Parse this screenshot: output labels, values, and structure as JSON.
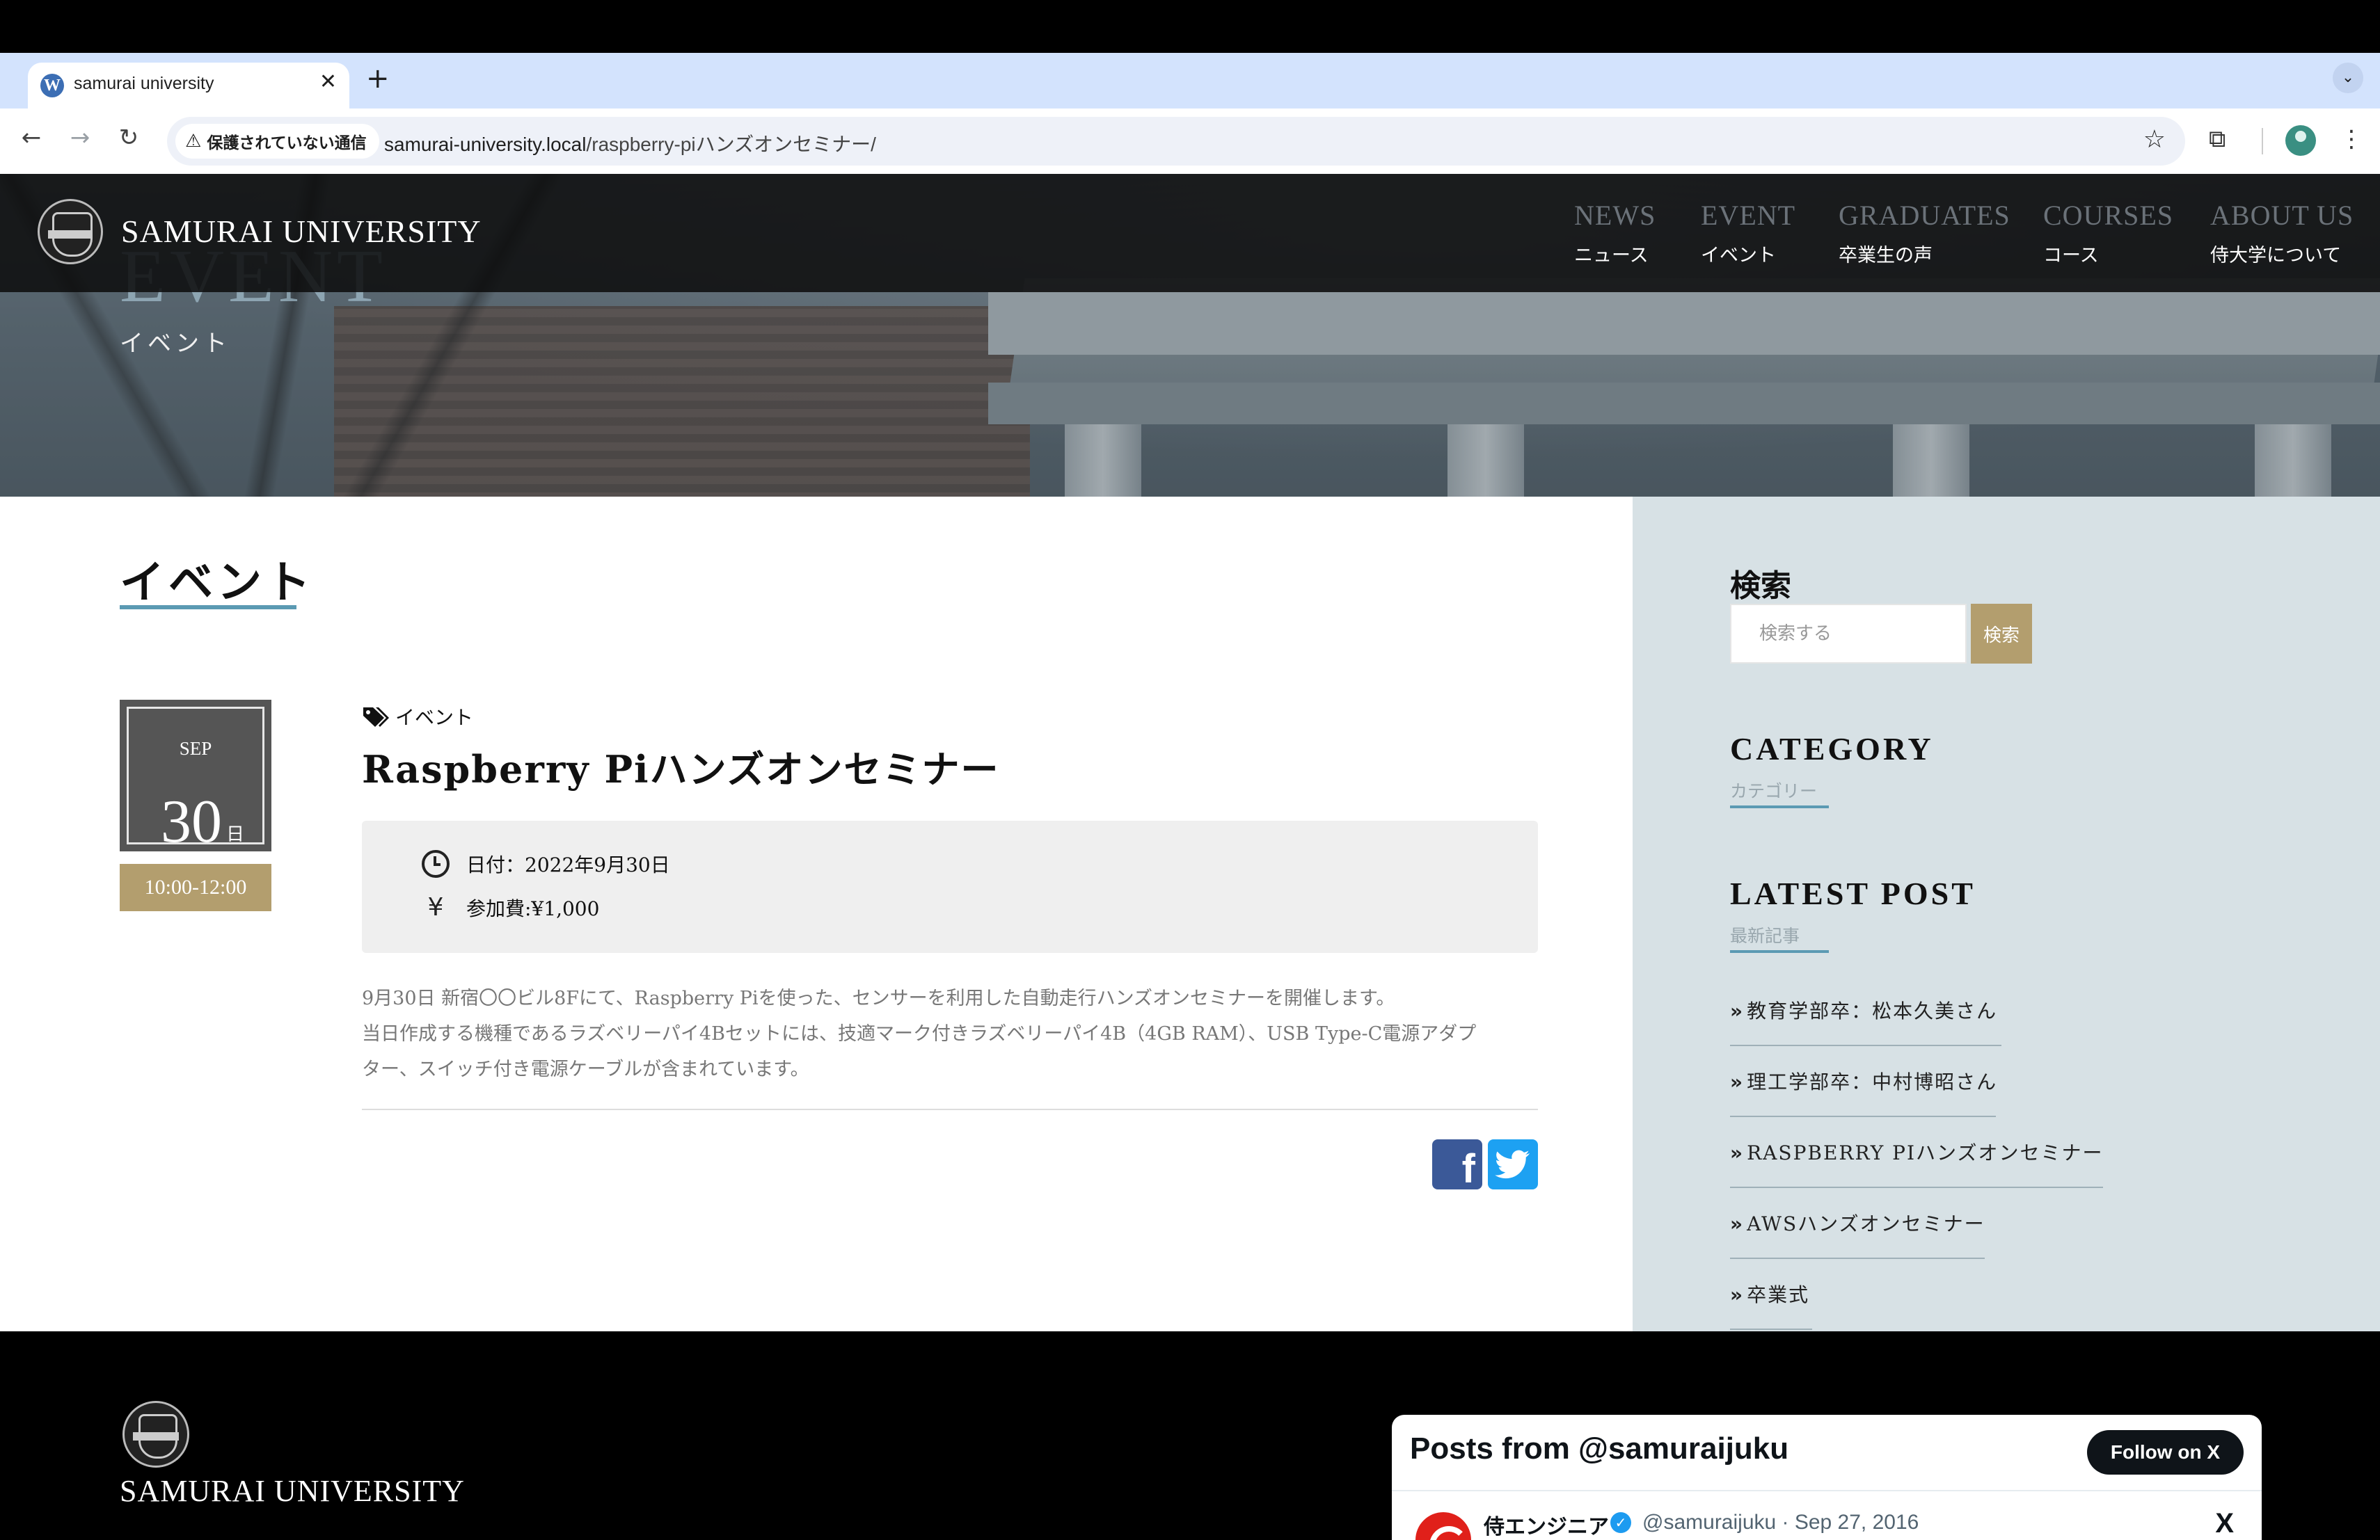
{
  "browser": {
    "tab_title": "samurai university",
    "tab_close": "✕",
    "new_tab": "+",
    "tab_menu": "⌄",
    "security_label": "保護されていない通信",
    "url_host": "samurai-university.local",
    "url_path": "/raspberry-piハンズオンセミナー/"
  },
  "site": {
    "logo_text": "SAMURAI UNIVERSITY",
    "nav": [
      {
        "en": "NEWS",
        "ja": "ニュース"
      },
      {
        "en": "EVENT",
        "ja": "イベント"
      },
      {
        "en": "GRADUATES",
        "ja": "卒業生の声"
      },
      {
        "en": "COURSES",
        "ja": "コース"
      },
      {
        "en": "ABOUT US",
        "ja": "侍大学について"
      }
    ]
  },
  "hero": {
    "title_en": "EVENT",
    "title_ja": "イベント"
  },
  "main": {
    "page_title": "イベント",
    "date": {
      "month": "SEP",
      "day": "30",
      "unit": "日",
      "time": "10:00-12:00"
    },
    "category": "イベント",
    "post_title": "Raspberry Piハンズオンセミナー",
    "info": {
      "date_text": "日付：2022年9月30日",
      "fee_text": "参加費:¥1,000",
      "yen_icon": "¥"
    },
    "body_lines": [
      "9月30日 新宿〇〇ビル8Fにて、Raspberry Piを使った、センサーを利用した自動走行ハンズオンセミナーを開催します。",
      "当日作成する機種であるラズベリーパイ4Bセットには、技適マーク付きラズベリーパイ4B（4GB RAM）、USB Type-C電源アダプ",
      "ター、スイッチ付き電源ケーブルが含まれています。"
    ],
    "share_fb": "f"
  },
  "sidebar": {
    "search_title": "検索",
    "search_placeholder": "検索する",
    "search_button": "検索",
    "category_title": "CATEGORY",
    "category_sub": "カテゴリー",
    "latest_title": "LATEST POST",
    "latest_sub": "最新記事",
    "chevron": "»",
    "posts": [
      "教育学部卒：松本久美さん",
      "理工学部卒：中村博昭さん",
      "RASPBERRY PIハンズオンセミナー",
      "AWSハンズオンセミナー",
      "卒業式"
    ]
  },
  "footer": {
    "logo_text": "SAMURAI UNIVERSITY",
    "widget": {
      "title": "Posts from @samuraijuku",
      "follow": "Follow on X",
      "author": "侍エンジニア",
      "verified": "✓",
      "meta": "@samuraijuku · Sep 27, 2016",
      "x_logo": "X"
    }
  }
}
